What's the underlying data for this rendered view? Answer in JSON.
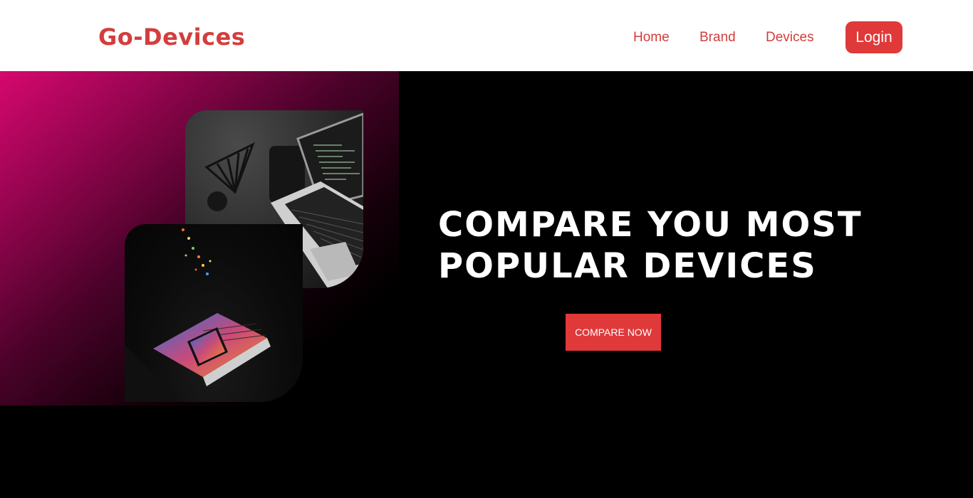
{
  "header": {
    "logo": "Go-Devices",
    "nav": [
      {
        "label": "Home"
      },
      {
        "label": "Brand"
      },
      {
        "label": "Devices"
      }
    ],
    "login_label": "Login"
  },
  "hero": {
    "title_line1": "COMPARE YOU MOST",
    "title_line2": "POPULAR DEVICES",
    "cta_label": "COMPARE NOW"
  },
  "colors": {
    "brand_red": "#d43d3d",
    "button_red": "#e0393a",
    "glow_pink": "#d6086e",
    "background": "#000000"
  }
}
